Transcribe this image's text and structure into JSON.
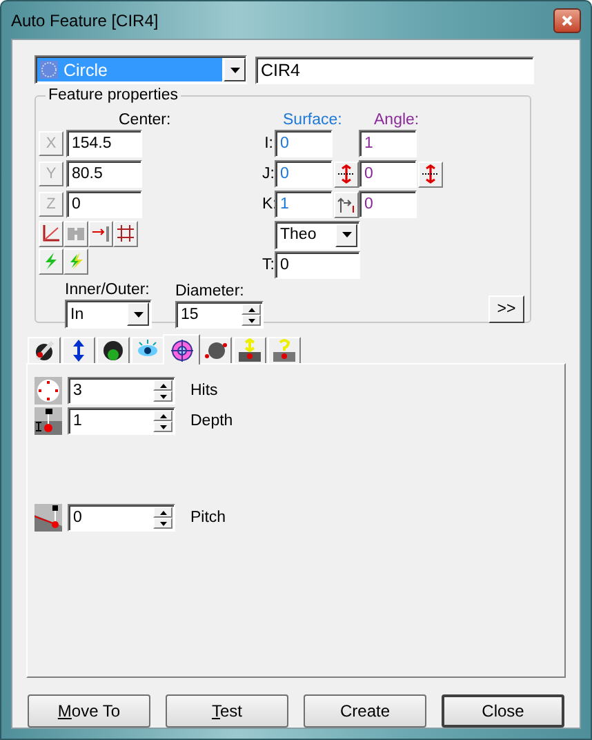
{
  "window": {
    "title": "Auto Feature [CIR4]"
  },
  "feature_type": {
    "value": "Circle"
  },
  "feature_id": {
    "value": "CIR4"
  },
  "feature_properties": {
    "title": "Feature properties",
    "center": {
      "label": "Center:",
      "fields": [
        {
          "axis": "X",
          "value": "154.5"
        },
        {
          "axis": "Y",
          "value": "80.5"
        },
        {
          "axis": "Z",
          "value": "0"
        }
      ]
    },
    "surface": {
      "label": "Surface:",
      "rows": [
        {
          "label": "I:",
          "value": "0"
        },
        {
          "label": "J:",
          "value": "0"
        },
        {
          "label": "K:",
          "value": "1"
        }
      ]
    },
    "angle": {
      "label": "Angle:",
      "values": [
        "1",
        "0",
        "0"
      ]
    },
    "measure_mode": {
      "value": "Theo"
    },
    "thickness": {
      "label": "T:",
      "value": "0"
    },
    "inner_outer": {
      "label": "Inner/Outer:",
      "value": "In"
    },
    "diameter": {
      "label": "Diameter:",
      "value": "15"
    },
    "more_button": ">>"
  },
  "tabs": [
    {
      "kind": "probe",
      "selected": false
    },
    {
      "kind": "arrows",
      "selected": false
    },
    {
      "kind": "globe",
      "selected": false
    },
    {
      "kind": "eye",
      "selected": false
    },
    {
      "kind": "target",
      "selected": true
    },
    {
      "kind": "path",
      "selected": false
    },
    {
      "kind": "move",
      "selected": false
    },
    {
      "kind": "query",
      "selected": false
    }
  ],
  "parameters": [
    {
      "kind": "hits",
      "label": "Hits",
      "value": "3"
    },
    {
      "kind": "depth",
      "label": "Depth",
      "value": "1"
    },
    {
      "kind": "pitch",
      "label": "Pitch",
      "value": "0"
    }
  ],
  "buttons": [
    {
      "label": "Move To",
      "mnemonic": true,
      "default": false
    },
    {
      "label": "Test",
      "mnemonic": true,
      "default": false
    },
    {
      "label": "Create",
      "mnemonic": false,
      "default": false
    },
    {
      "label": "Close",
      "mnemonic": false,
      "default": true
    }
  ]
}
